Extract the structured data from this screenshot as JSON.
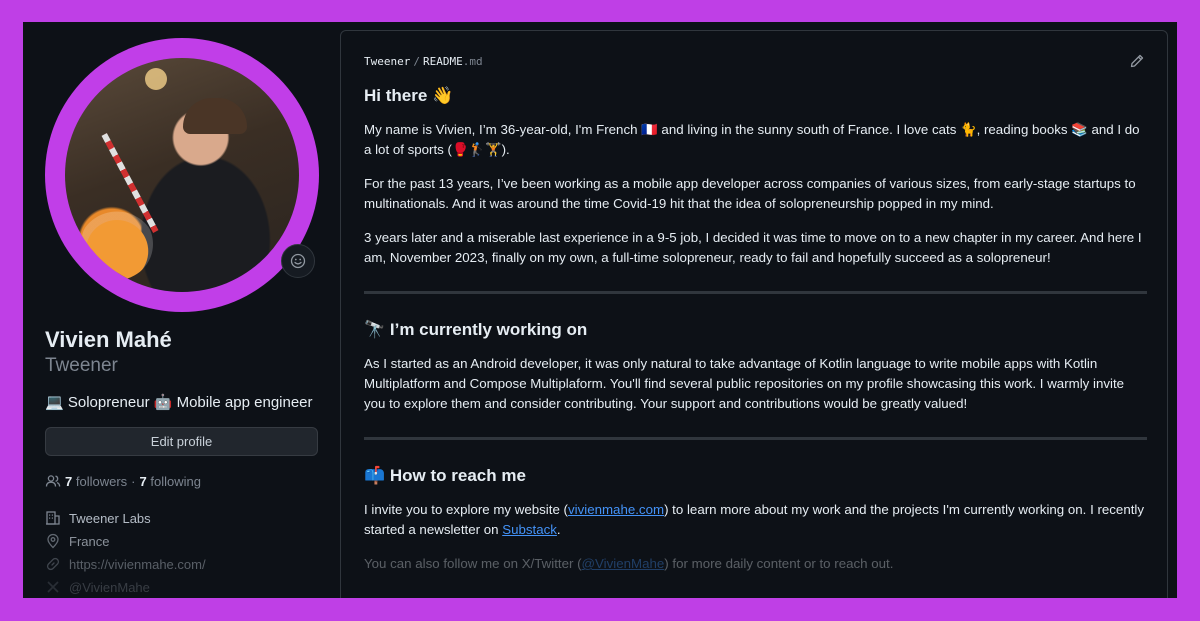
{
  "profile": {
    "name": "Vivien Mahé",
    "login": "Tweener",
    "bio": "💻 Solopreneur 🤖 Mobile app engineer",
    "edit_label": "Edit profile",
    "followers_count": "7",
    "followers_label": "followers",
    "following_count": "7",
    "following_label": "following",
    "dot": "·",
    "company": "Tweener Labs",
    "location": "France",
    "website": "https://vivienmahe.com/",
    "twitter": "@VivienMahe"
  },
  "readme": {
    "owner": "Tweener",
    "separator": "/",
    "file_name": "README",
    "file_ext": ".md",
    "intro": {
      "heading": "Hi there 👋",
      "p1": "My name is Vivien, I’m 36-year-old, I'm French 🇫🇷 and living in the sunny south of France. I love cats 🐈, reading books 📚 and I do a lot of sports (🥊🏌️🏋️).",
      "p2": "For the past 13 years, I’ve been working as a mobile app developer across companies of various sizes, from early-stage startups to multinationals. And it was around the time Covid-19 hit that the idea of solopreneurship popped in my mind.",
      "p3": "3 years later and a miserable last experience in a 9-5 job, I decided it was time to move on to a new chapter in my career. And here I am, November 2023, finally on my own, a full-time solopreneur, ready to fail and hopefully succeed as a solopreneur!"
    },
    "working": {
      "heading": "🔭 I’m currently working on",
      "p1": "As I started as an Android developer, it was only natural to take advantage of Kotlin language to write mobile apps with Kotlin Multiplatform and Compose Multiplaform. You'll find several public repositories on my profile showcasing this work. I warmly invite you to explore them and consider contributing. Your support and contributions would be greatly valued!"
    },
    "reach": {
      "heading": "📫 How to reach me",
      "p1_a": "I invite you to explore my website (",
      "website_link": "vivienmahe.com",
      "p1_b": ") to learn more about my work and the projects I'm currently working on. I recently started a newsletter on ",
      "substack_link": "Substack",
      "p1_c": ".",
      "p2_a": "You can also follow me on X/Twitter (",
      "twitter_link": "@VivienMahe",
      "p2_b": ") for more daily content or to reach out."
    }
  },
  "colors": {
    "frame_border": "#bf3fe6",
    "background": "#0d1117",
    "avatar_ring": "#c13ee8",
    "link": "#4493f8",
    "muted": "#7d8590",
    "text": "#e6edf3"
  },
  "icons": [
    "smiley-icon",
    "people-icon",
    "building-icon",
    "location-icon",
    "link-icon",
    "x-logo-icon",
    "pencil-icon"
  ]
}
